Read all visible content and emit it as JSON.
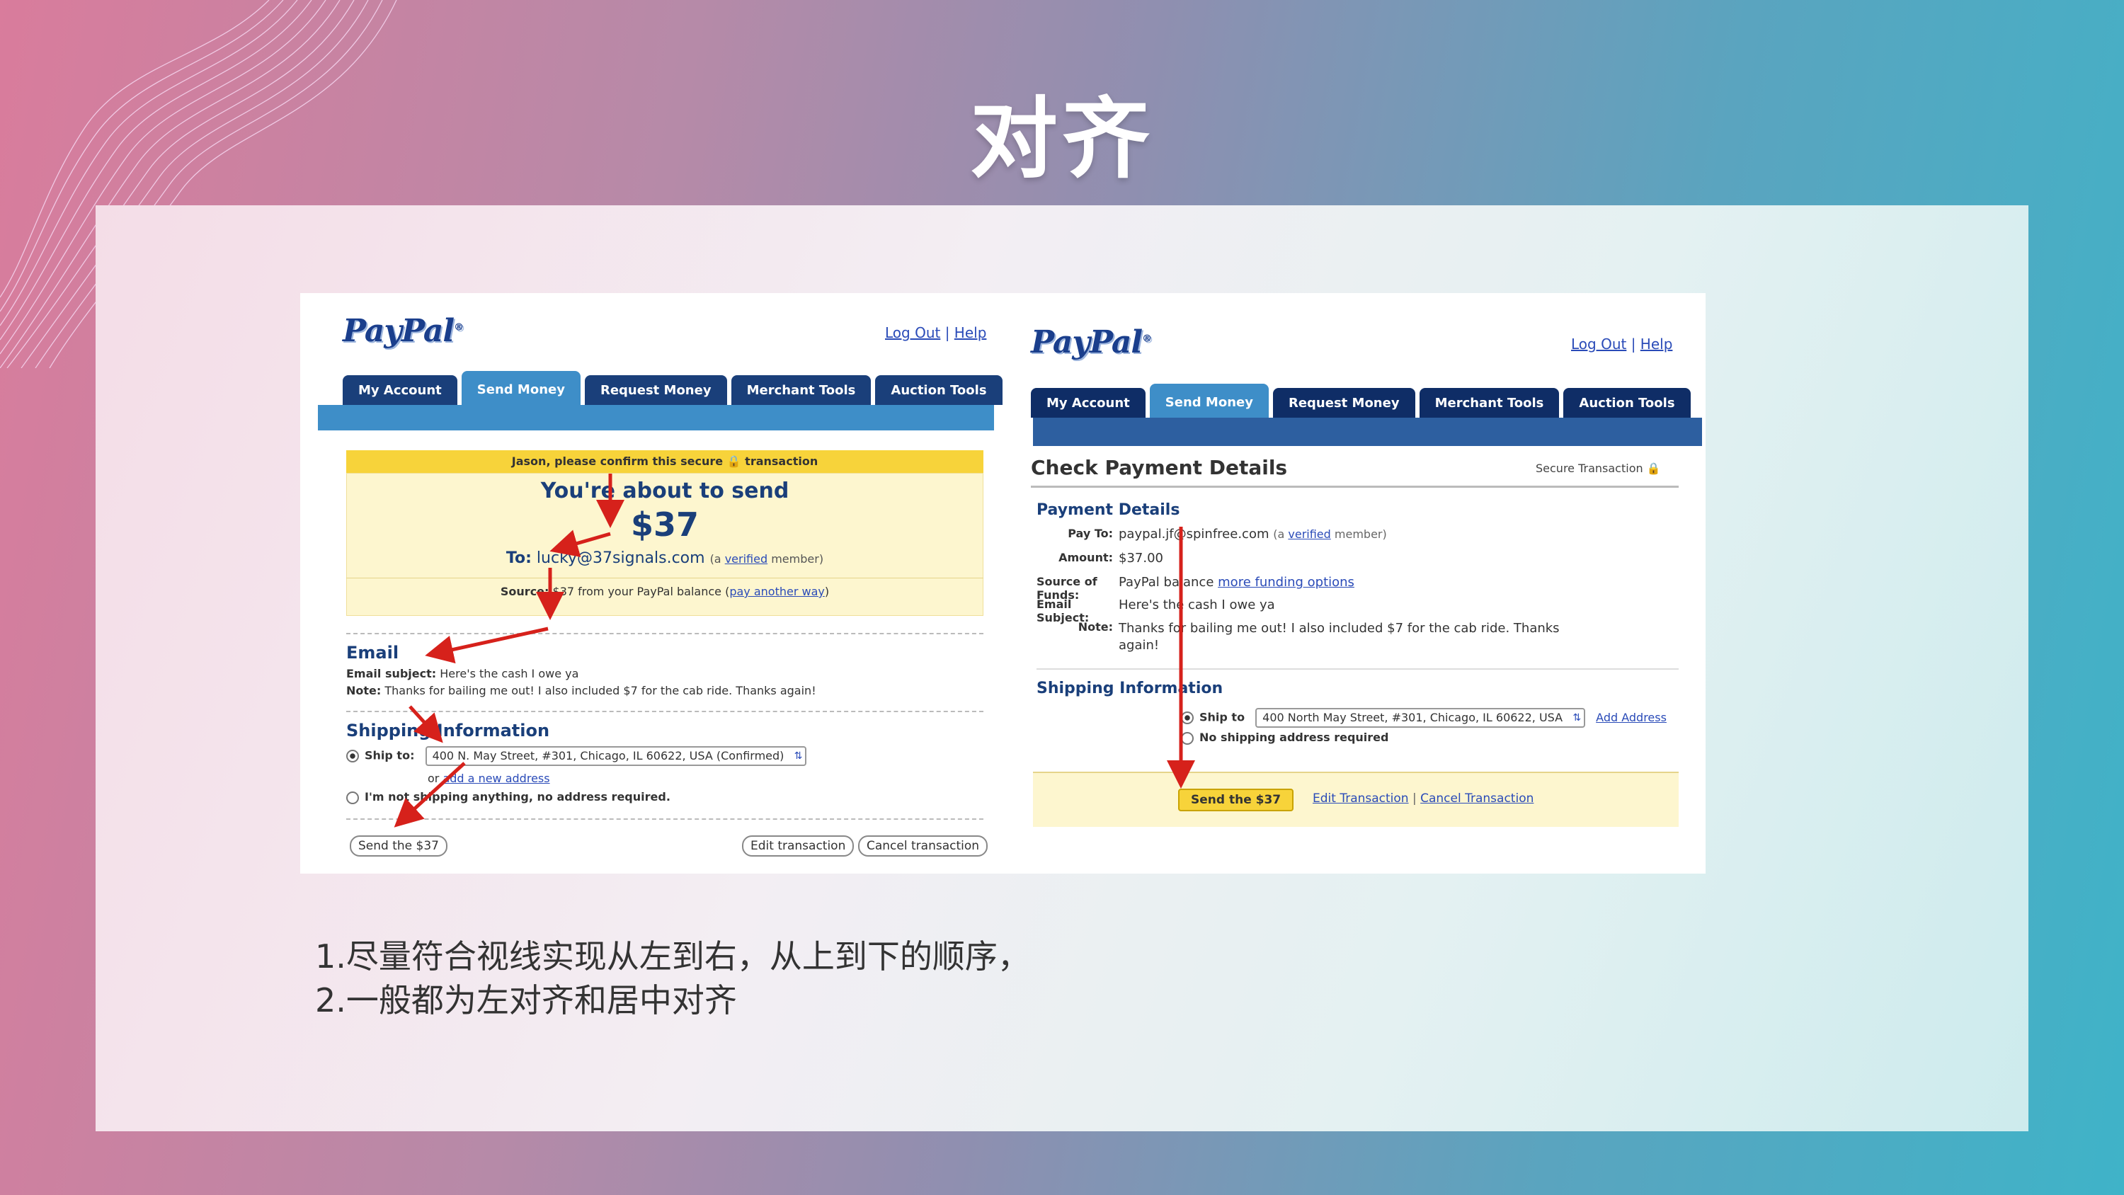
{
  "slide": {
    "title": "对齐",
    "captions": [
      "1.尽量符合视线实现从左到右，从上到下的顺序，",
      "2.一般都为左对齐和居中对齐"
    ]
  },
  "left": {
    "logo": "PayPal",
    "logout": "Log Out",
    "help": "Help",
    "tabs": [
      "My Account",
      "Send Money",
      "Request Money",
      "Merchant Tools",
      "Auction Tools"
    ],
    "confirm_banner": "Jason, please confirm this secure",
    "confirm_banner_end": "transaction",
    "about_to_send": "You're about to send",
    "amount": "$37",
    "to_label": "To:",
    "to_email": "lucky@37signals.com",
    "to_note_pre": "(a",
    "to_verified": "verified",
    "to_note_post": "member)",
    "source_label": "Source:",
    "source_text": "$37 from your PayPal balance (",
    "source_link": "pay another way",
    "source_end": ")",
    "email_heading": "Email",
    "email_subject_label": "Email subject:",
    "email_subject": "Here's the cash I owe ya",
    "note_label": "Note:",
    "note": "Thanks for bailing me out! I also included $7 for the cab ride. Thanks again!",
    "shipping_heading": "Shipping Information",
    "ship_to_label": "Ship to:",
    "ship_to_value": "400 N. May Street, #301, Chicago, IL 60622, USA (Confirmed)",
    "or": "or",
    "add_new_address": "add a new address",
    "not_shipping": "I'm not shipping anything, no address required.",
    "send_button": "Send the $37",
    "edit_button": "Edit transaction",
    "cancel_button": "Cancel transaction"
  },
  "right": {
    "logo": "PayPal",
    "logout": "Log Out",
    "help": "Help",
    "tabs": [
      "My Account",
      "Send Money",
      "Request Money",
      "Merchant Tools",
      "Auction Tools"
    ],
    "page_heading": "Check Payment Details",
    "secure": "Secure Transaction",
    "payment_heading": "Payment Details",
    "pay_to_label": "Pay To:",
    "pay_to": "paypal.jf@spinfree.com",
    "pay_to_pre": "(a",
    "pay_to_verified": "verified",
    "pay_to_post": "member)",
    "amount_label": "Amount:",
    "amount": "$37.00",
    "funds_label": "Source of Funds:",
    "funds": "PayPal balance",
    "funds_link": "more funding options",
    "subject_label": "Email Subject:",
    "subject": "Here's the cash I owe ya",
    "note_label": "Note:",
    "note": "Thanks for bailing me out! I also included $7 for the cab ride. Thanks again!",
    "shipping_heading": "Shipping Information",
    "ship_to_label": "Ship to",
    "ship_to_value": "400 North May Street, #301, Chicago, IL 60622, USA",
    "add_address": "Add Address",
    "no_shipping": "No shipping address required",
    "send_button": "Send the $37",
    "edit_link": "Edit Transaction",
    "cancel_link": "Cancel Transaction"
  },
  "colors": {
    "arrow": "#d6211b",
    "paypal_blue": "#1a3f7a",
    "tab_active": "#3e8ec8",
    "banner_yellow": "#f7d33a",
    "panel_yellow": "#fdf6cf"
  }
}
